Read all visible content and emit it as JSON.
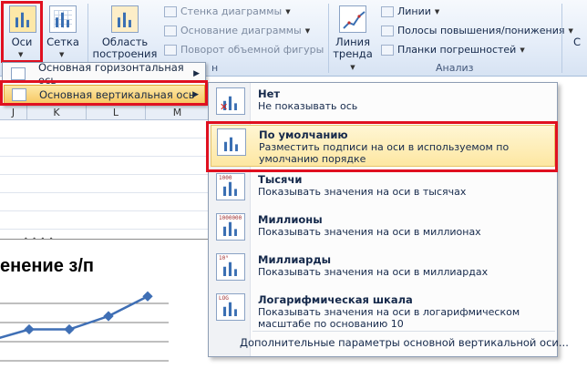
{
  "ribbon": {
    "axes_label": "Оси",
    "gridlines_label": "Сетка",
    "plot_area_label_1": "Область",
    "plot_area_label_2": "построения",
    "chart_wall": "Стенка диаграммы",
    "chart_floor": "Основание диаграммы",
    "rotation_3d": "Поворот объемной фигуры",
    "trendline_label_1": "Линия",
    "trendline_label_2": "тренда",
    "lines": "Линии",
    "up_down_bars": "Полосы повышения/понижения",
    "error_bars": "Планки погрешностей",
    "analysis_group": "Анализ",
    "background_group_fragment": "н",
    "right_cut_label": "С"
  },
  "axes_menu": {
    "items": [
      {
        "label": "Основная горизонтальная ось"
      },
      {
        "label": "Основная вертикальная ось"
      }
    ]
  },
  "columns": [
    "J",
    "K",
    "L",
    "M"
  ],
  "chart": {
    "title_fragment": "енение з/п",
    "chart_data": {
      "type": "line",
      "x": [
        1,
        2,
        3,
        4
      ],
      "values": [
        0.55,
        0.55,
        0.67,
        0.85
      ],
      "ylim": [
        0,
        1
      ]
    }
  },
  "vertical_axis_menu": {
    "options": [
      {
        "title": "Нет",
        "desc": "Не показывать ось",
        "icon": "no-axis-icon",
        "tag": ""
      },
      {
        "title": "По умолчанию",
        "desc": "Разместить подписи на оси в используемом по умолчанию порядке",
        "icon": "default-axis-icon",
        "tag": ""
      },
      {
        "title": "Тысячи",
        "desc": "Показывать значения на оси в тысячах",
        "icon": "thousands-axis-icon",
        "tag": "1000"
      },
      {
        "title": "Миллионы",
        "desc": "Показывать значения на оси в миллионах",
        "icon": "millions-axis-icon",
        "tag": "1000000"
      },
      {
        "title": "Миллиарды",
        "desc": "Показывать значения на оси в миллиардах",
        "icon": "billions-axis-icon",
        "tag": "10⁹"
      },
      {
        "title": "Логарифмическая шкала",
        "desc": "Показывать значения на оси в логарифмическом масштабе по основанию 10",
        "icon": "log-axis-icon",
        "tag": "LOG"
      }
    ],
    "more_options": "Дополнительные параметры основной вертикальной оси..."
  },
  "colors": {
    "highlight_border": "#e01020",
    "menu_hover": "#f7c660",
    "series_line": "#3f6fb5"
  }
}
